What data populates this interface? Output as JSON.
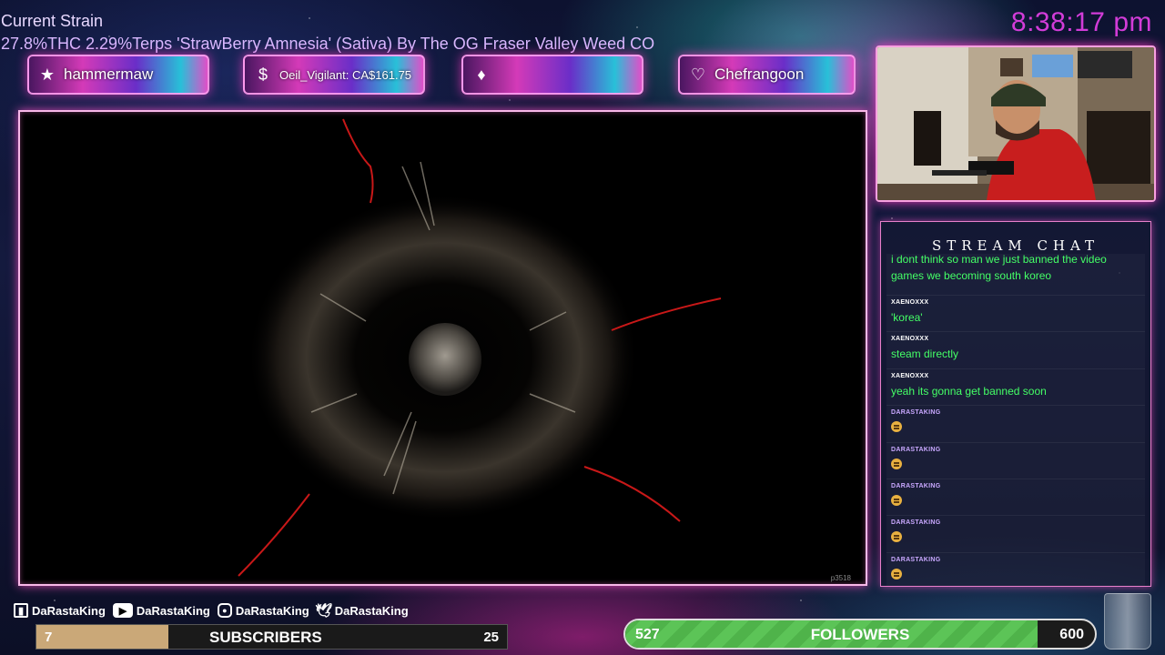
{
  "strain": {
    "title": "Current Strain",
    "description": "27.8%THC 2.29%Terps 'StrawBerry Amnesia' (Sativa) By The OG Fraser Valley Weed CO"
  },
  "clock": "8:38:17 pm",
  "alerts": [
    {
      "icon": "star-icon",
      "text": "hammermaw"
    },
    {
      "icon": "dollar-icon",
      "text": "Oeil_Vigilant: CA$161.75"
    },
    {
      "icon": "diamond-icon",
      "text": ""
    },
    {
      "icon": "heart-icon",
      "text": "Chefrangoon"
    }
  ],
  "game": {
    "watermark": "p3518"
  },
  "chat": {
    "title": "STREAM CHAT",
    "messages": [
      {
        "user": "",
        "text": "i dont think so man we just banned the video games we becoming south koreo",
        "emoji": false
      },
      {
        "user": "XAENOXXX",
        "text": "'korea'",
        "emoji": false
      },
      {
        "user": "XAENOXXX",
        "text": "steam directly",
        "emoji": false
      },
      {
        "user": "XAENOXXX",
        "text": "yeah its gonna get banned soon",
        "emoji": false
      },
      {
        "user": "DARASTAKING",
        "text": "",
        "emoji": true
      },
      {
        "user": "DARASTAKING",
        "text": "",
        "emoji": true
      },
      {
        "user": "DARASTAKING",
        "text": "",
        "emoji": true
      },
      {
        "user": "DARASTAKING",
        "text": "",
        "emoji": true
      },
      {
        "user": "DARASTAKING",
        "text": "",
        "emoji": true
      }
    ]
  },
  "socials": [
    {
      "icon": "twitch-icon",
      "handle": "DaRastaKing"
    },
    {
      "icon": "youtube-icon",
      "handle": "DaRastaKing"
    },
    {
      "icon": "instagram-icon",
      "handle": "DaRastaKing"
    },
    {
      "icon": "twitter-icon",
      "handle": "DaRastaKing"
    }
  ],
  "subscribers": {
    "label": "SUBSCRIBERS",
    "current": "7",
    "goal": "25",
    "progress": 0.28
  },
  "followers": {
    "label": "FOLLOWERS",
    "current": "527",
    "goal": "600",
    "progress": 0.878
  },
  "colors": {
    "clock": "#d23cd8",
    "chat_text": "#44ff66",
    "neon_border": "#f8b8e8",
    "followers_fill": "#4fb34a",
    "subs_fill": "#caa878"
  }
}
